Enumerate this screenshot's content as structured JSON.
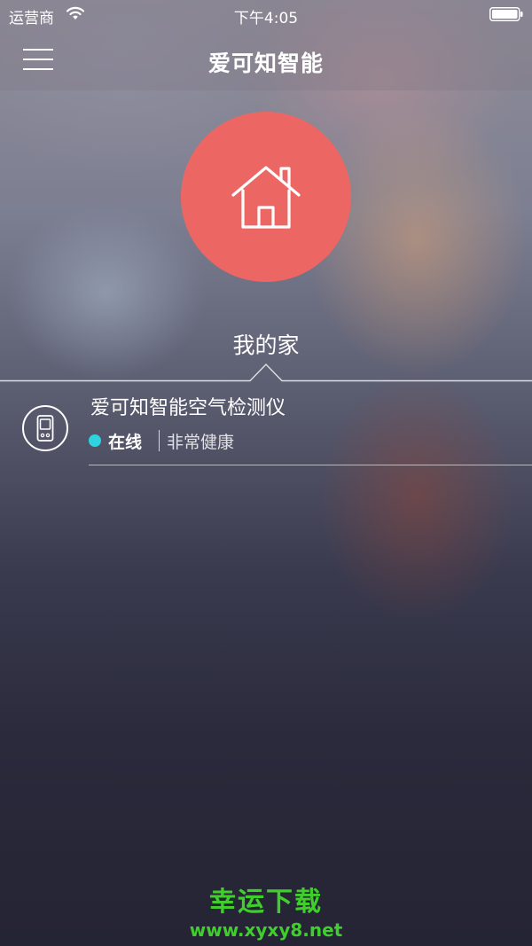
{
  "status_bar": {
    "carrier": "运营商",
    "time": "下午4:05"
  },
  "header": {
    "title": "爱可知智能"
  },
  "home": {
    "name": "我的家",
    "circle_color": "#ec6764"
  },
  "devices": [
    {
      "name": "爱可知智能空气检测仪",
      "status": "在线",
      "status_color": "#2fd3e0",
      "air_quality": "非常健康"
    }
  ],
  "watermark": {
    "title": "幸运下载",
    "url": "www.xyxy8.net",
    "color": "#3fce2c"
  }
}
